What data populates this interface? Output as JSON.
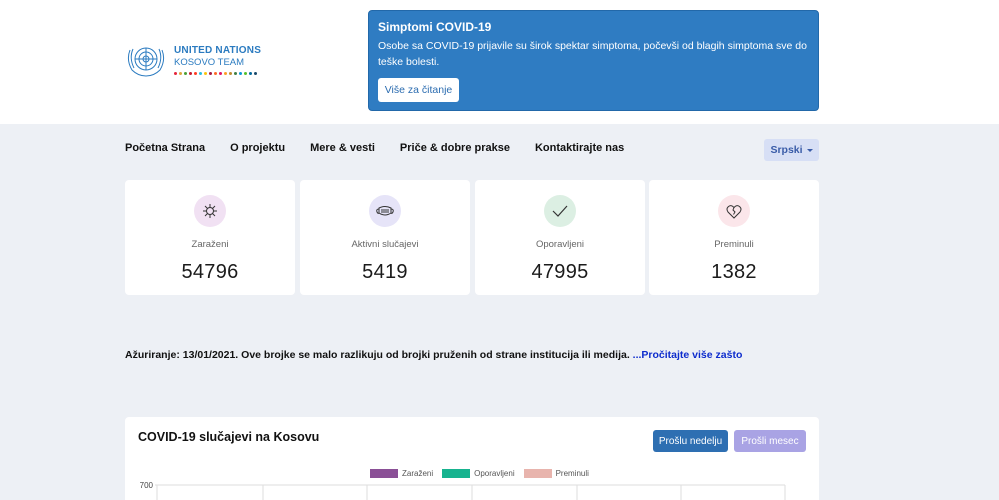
{
  "header": {
    "logo": {
      "line1": "UNITED NATIONS",
      "line2": "KOSOVO TEAM",
      "emblem_icon": "un-emblem-icon"
    }
  },
  "alert": {
    "title": "Simptomi COVID-19",
    "text": "Osobe sa COVID-19 prijavile su širok spektar simptoma, počevši od blagih simptoma sve do teške bolesti.",
    "button_label": "Više za čitanje"
  },
  "nav": {
    "items": [
      {
        "label": "Početna Strana"
      },
      {
        "label": "O projektu"
      },
      {
        "label": "Mere & vesti"
      },
      {
        "label": "Priče & dobre prakse"
      },
      {
        "label": "Kontaktirajte nas"
      }
    ],
    "language": "Srpski"
  },
  "stats": [
    {
      "label": "Zaraženi",
      "value": "54796",
      "icon": "virus-icon",
      "color": "#f1e1f3"
    },
    {
      "label": "Aktivni slučajevi",
      "value": "5419",
      "icon": "face-mask-icon",
      "color": "#e6e4f8"
    },
    {
      "label": "Oporavljeni",
      "value": "47995",
      "icon": "checkmark-icon",
      "color": "#dcefe3"
    },
    {
      "label": "Preminuli",
      "value": "1382",
      "icon": "broken-heart-icon",
      "color": "#fbe6ea"
    }
  ],
  "update": {
    "text": "Ažuriranje: 13/01/2021. Ove brojke se malo razlikuju od brojki pruženih od strane institucija ili medija. ",
    "link": "...Pročitajte više zašto"
  },
  "chart": {
    "title": "COVID-19 slučajevi na Kosovu",
    "week_button": "Prošlu nedelju",
    "month_button": "Prošli mesec",
    "chart_data": {
      "type": "bar",
      "series": [
        {
          "name": "Zaraženi",
          "color": "#8a4f96"
        },
        {
          "name": "Oporavljeni",
          "color": "#17b38f"
        },
        {
          "name": "Preminuli",
          "color": "#e8b4ad"
        }
      ],
      "y_ticks": [
        "700"
      ],
      "ylim": [
        0,
        700
      ]
    }
  }
}
